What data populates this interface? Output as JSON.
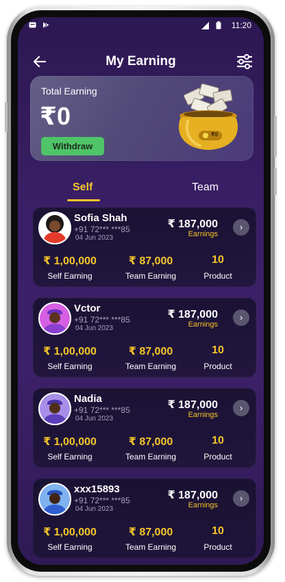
{
  "status_bar": {
    "time": "11:20",
    "icons": [
      "message-icon",
      "play-store-icon",
      "signal-icon",
      "battery-icon"
    ]
  },
  "header": {
    "title": "My Earning",
    "back_icon": "arrow-left-icon",
    "filter_icon": "sliders-icon"
  },
  "total": {
    "label": "Total Earning",
    "amount": "₹0",
    "withdraw_label": "Withdraw",
    "pot_tag": "₹0"
  },
  "tabs": [
    {
      "label": "Self",
      "active": true
    },
    {
      "label": "Team",
      "active": false
    }
  ],
  "members": [
    {
      "name": "Sofia Shah",
      "phone": "+91 72*** ***85",
      "date": "04 Jun 2023",
      "amount": "₹ 187,000",
      "amount_label": "Earnings",
      "self_earning": "₹ 1,00,000",
      "self_label": "Self Earning",
      "team_earning": "₹ 87,000",
      "team_label": "Team Earning",
      "product": "10",
      "product_label": "Product",
      "avatar_bg": "#ffffff",
      "shirt": "#e53a2b"
    },
    {
      "name": "Vctor",
      "phone": "+91 72*** ***85",
      "date": "04 Jun 2023",
      "amount": "₹ 187,000",
      "amount_label": "Earnings",
      "self_earning": "₹ 1,00,000",
      "self_label": "Self Earning",
      "team_earning": "₹ 87,000",
      "team_label": "Team Earning",
      "product": "10",
      "product_label": "Product",
      "avatar_bg": "#d55fe3",
      "shirt": "#8a3fd0"
    },
    {
      "name": "Nadia",
      "phone": "+91 72*** ***85",
      "date": "04 Jun 2023",
      "amount": "₹ 187,000",
      "amount_label": "Earnings",
      "self_earning": "₹ 1,00,000",
      "self_label": "Self Earning",
      "team_earning": "₹ 87,000",
      "team_label": "Team Earning",
      "product": "10",
      "product_label": "Product",
      "avatar_bg": "#a88ee8",
      "shirt": "#5b3fb8"
    },
    {
      "name": "xxx15893",
      "phone": "+91 72*** ***85",
      "date": "04 Jun 2023",
      "amount": "₹ 187,000",
      "amount_label": "Earnings",
      "self_earning": "₹ 1,00,000",
      "self_label": "Self Earning",
      "team_earning": "₹ 87,000",
      "team_label": "Team Earning",
      "product": "10",
      "product_label": "Product",
      "avatar_bg": "#7fb2f0",
      "shirt": "#2f5fcf"
    }
  ]
}
